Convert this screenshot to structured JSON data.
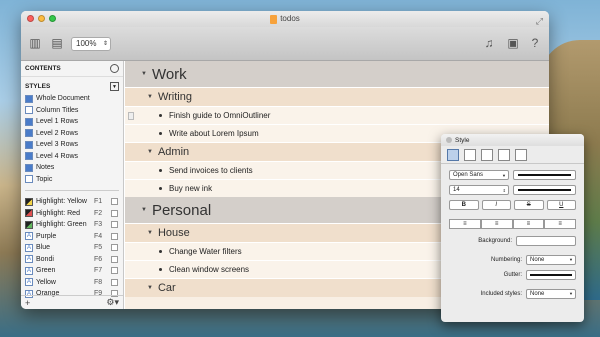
{
  "window": {
    "title": "todos"
  },
  "toolbar": {
    "zoom": "100%"
  },
  "sidebar": {
    "contents_label": "CONTENTS",
    "styles_label": "STYLES",
    "style_items": [
      {
        "label": "Whole Document",
        "icon": "filled"
      },
      {
        "label": "Column Titles",
        "icon": "plain"
      },
      {
        "label": "Level 1 Rows",
        "icon": "filled"
      },
      {
        "label": "Level 2 Rows",
        "icon": "filled"
      },
      {
        "label": "Level 3 Rows",
        "icon": "filled"
      },
      {
        "label": "Level 4 Rows",
        "icon": "filled"
      },
      {
        "label": "Notes",
        "icon": "filled"
      },
      {
        "label": "Topic",
        "icon": "plain"
      }
    ],
    "named_styles": [
      {
        "label": "Highlight: Yellow",
        "key": "F1",
        "icon": "hl-yellow"
      },
      {
        "label": "Highlight: Red",
        "key": "F2",
        "icon": "hl-red"
      },
      {
        "label": "Highlight: Green",
        "key": "F3",
        "icon": "hl-green"
      },
      {
        "label": "Purple",
        "key": "F4",
        "icon": "letter"
      },
      {
        "label": "Blue",
        "key": "F5",
        "icon": "letter"
      },
      {
        "label": "Bondi",
        "key": "F6",
        "icon": "letter"
      },
      {
        "label": "Green",
        "key": "F7",
        "icon": "letter"
      },
      {
        "label": "Yellow",
        "key": "F8",
        "icon": "letter"
      },
      {
        "label": "Orange",
        "key": "F9",
        "icon": "letter"
      }
    ],
    "add_label": "+",
    "gear_label": "⚙▾"
  },
  "outline": {
    "work": "Work",
    "writing": "Writing",
    "finish_guide": "Finish guide to OmniOutliner",
    "write_about": "Write about Lorem Ipsum",
    "admin": "Admin",
    "send_invoices": "Send invoices to clients",
    "buy_ink": "Buy new ink",
    "personal": "Personal",
    "house": "House",
    "change_filters": "Change Water filters",
    "clean_windows": "Clean window screens",
    "car": "Car"
  },
  "inspector": {
    "title": "Style",
    "font": "Open Sans",
    "size": "14",
    "bold": "B",
    "italic": "I",
    "strike": "S",
    "underline": "U",
    "background_label": "Background:",
    "numbering_label": "Numbering:",
    "numbering_value": "None",
    "gutter_label": "Gutter:",
    "included_label": "Included styles:",
    "included_value": "None"
  }
}
